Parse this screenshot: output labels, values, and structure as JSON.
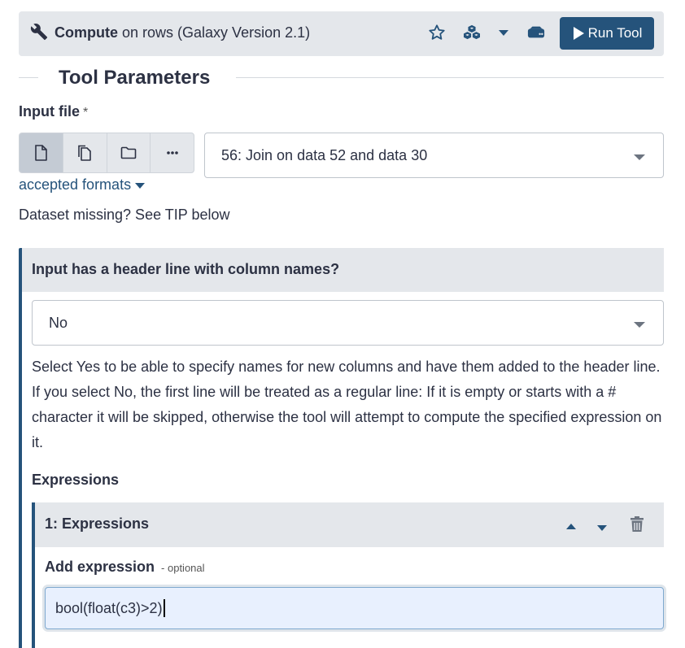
{
  "header": {
    "tool_name": "Compute",
    "tool_subtitle": "on rows (Galaxy Version 2.1)",
    "run_label": "Run Tool"
  },
  "section_title": "Tool Parameters",
  "input_file": {
    "label": "Input file",
    "required_mark": "*",
    "selected": "56: Join on data 52 and data 30",
    "accepted_formats_label": "accepted formats",
    "missing_hint": "Dataset missing? See TIP below"
  },
  "header_line": {
    "label": "Input has a header line with column names?",
    "selected": "No",
    "help": "Select Yes to be able to specify names for new columns and have them added to the header line. If you select No, the first line will be treated as a regular line: If it is empty or starts with a # character it will be skipped, otherwise the tool will attempt to compute the specified expression on it."
  },
  "expressions": {
    "label": "Expressions",
    "repeat_title": "1: Expressions",
    "add_label": "Add expression",
    "optional_label": "- optional",
    "value": "bool(float(c3)>2)"
  },
  "colors": {
    "primary": "#25537b",
    "panel": "#e4e7eb"
  }
}
